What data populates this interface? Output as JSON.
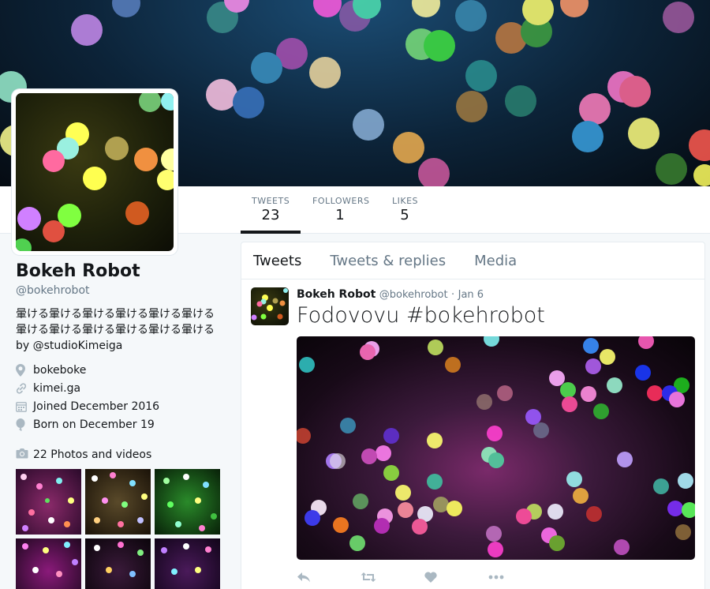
{
  "banner": {
    "icon": "bokeh-banner"
  },
  "nav": {
    "stats": [
      {
        "label": "TWEETS",
        "value": "23"
      },
      {
        "label": "FOLLOWERS",
        "value": "1"
      },
      {
        "label": "LIKES",
        "value": "5"
      }
    ],
    "active_stat": "TWEETS"
  },
  "profile": {
    "name": "Bokeh Robot",
    "handle": "@bokehrobot",
    "bio": "暈ける暈ける暈ける暈ける暈ける暈ける暈ける暈ける暈ける暈ける暈ける暈ける by @studioKimeiga",
    "location": "bokeboke",
    "url": "kimei.ga",
    "joined": "Joined December 2016",
    "born": "Born on December 19",
    "icons": {
      "location": "map-pin-icon",
      "url": "link-icon",
      "joined": "calendar-icon",
      "born": "balloon-icon"
    }
  },
  "photos": {
    "label": "22 Photos and videos",
    "icon": "camera-icon"
  },
  "timeline": {
    "tabs": [
      "Tweets",
      "Tweets & replies",
      "Media"
    ],
    "active_tab": "Tweets",
    "tweet": {
      "name": "Bokeh Robot",
      "handle": "@bokehrobot",
      "separator": "·",
      "time": "Jan 6",
      "text": "Fodovovu #bokehrobot",
      "actions": [
        "reply-icon",
        "retweet-icon",
        "like-icon",
        "more-icon"
      ]
    }
  },
  "colors": {
    "accent": "#14171a",
    "muted": "#657786",
    "border": "#e6ecf0",
    "page_bg": "#f5f8fa",
    "icon_gray": "#aab8c2"
  }
}
